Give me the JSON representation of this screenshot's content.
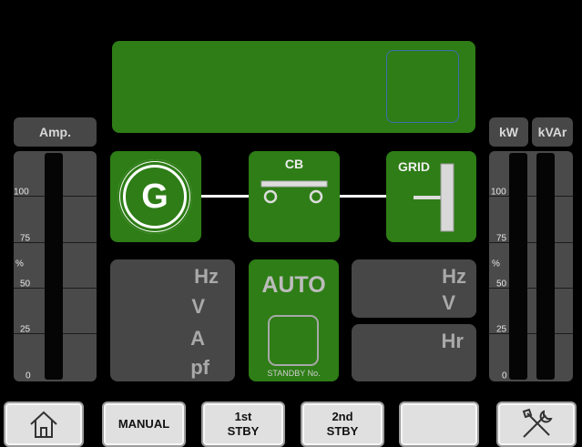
{
  "top_display": {
    "text": ""
  },
  "left_meter": {
    "header": "Amp.",
    "ticks": [
      "100",
      "75",
      "50",
      "25",
      "0"
    ],
    "percent_label": "%",
    "level": 0
  },
  "right_meter": {
    "header_kw": "kW",
    "header_kvar": "kVAr",
    "ticks": [
      "100",
      "75",
      "50",
      "25",
      "0"
    ],
    "percent_label": "%",
    "kw_level": 0,
    "kvar_level": 0
  },
  "one_line": {
    "generator_symbol": "G",
    "cb_label": "CB",
    "grid_label": "GRID"
  },
  "gen_readings": {
    "units": [
      "Hz",
      "V",
      "A",
      "pf"
    ]
  },
  "mode_panel": {
    "mode": "AUTO",
    "standby_label": "STANDBY No."
  },
  "grid_readings": {
    "units": [
      "Hz",
      "V"
    ]
  },
  "hours_panel": {
    "unit": "Hr"
  },
  "buttons": {
    "home_icon": "home-icon",
    "manual": "MANUAL",
    "first_stby_line1": "1st",
    "first_stby_line2": "STBY",
    "second_stby_line1": "2nd",
    "second_stby_line2": "STBY",
    "blank": "",
    "tools_icon": "tools-icon"
  },
  "colors": {
    "active_green": "#2e7d16",
    "panel_gray": "#474747",
    "background": "#000000"
  }
}
